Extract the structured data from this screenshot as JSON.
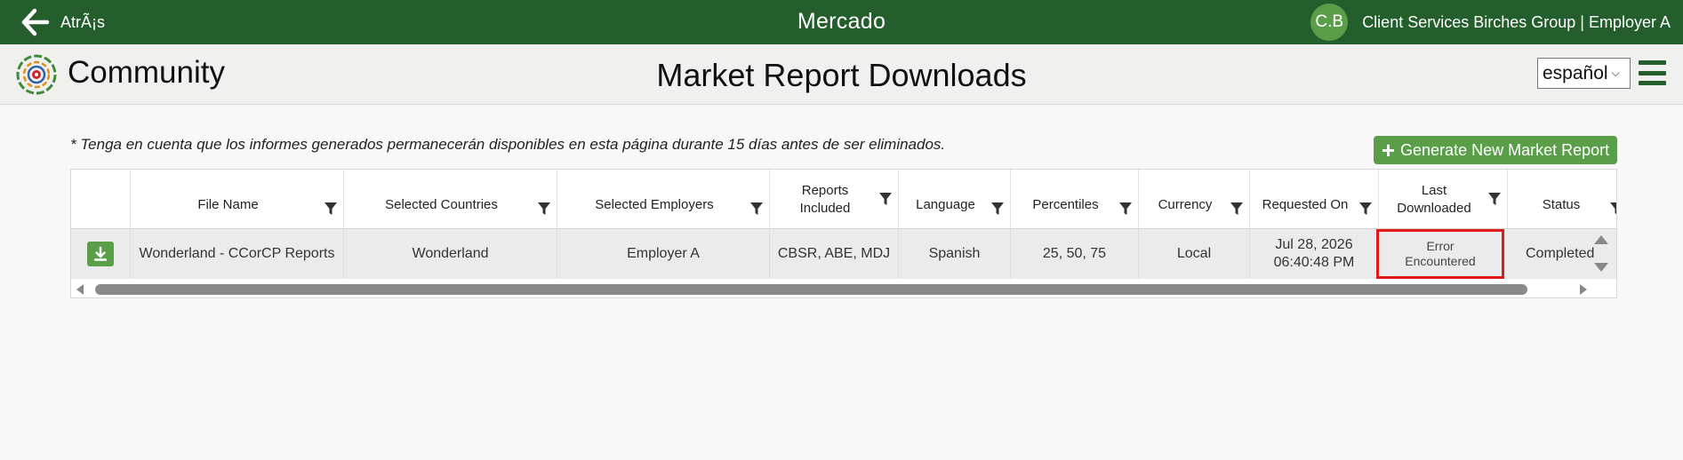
{
  "topbar": {
    "back_label": "AtrÃ¡s",
    "app_title": "Mercado",
    "avatar_initials": "C.B",
    "user_name": "Client Services Birches Group | Employer A"
  },
  "header": {
    "brand": "Community",
    "page_title": "Market Report Downloads",
    "language_selected": "español",
    "menu_icon": "hamburger-icon"
  },
  "note": "* Tenga en cuenta que los informes generados permanecerán disponibles en esta página durante 15 días antes de ser eliminados.",
  "generate_button": {
    "label": "Generate New Market Report",
    "icon": "plus-icon"
  },
  "table": {
    "columns": [
      {
        "key": "download",
        "label": ""
      },
      {
        "key": "file_name",
        "label": "File Name"
      },
      {
        "key": "countries",
        "label": "Selected Countries"
      },
      {
        "key": "employers",
        "label": "Selected Employers"
      },
      {
        "key": "reports",
        "label": "Reports Included"
      },
      {
        "key": "language",
        "label": "Language"
      },
      {
        "key": "percentiles",
        "label": "Percentiles"
      },
      {
        "key": "currency",
        "label": "Currency"
      },
      {
        "key": "requested",
        "label": "Requested On"
      },
      {
        "key": "last_downloaded",
        "label": "Last Downloaded"
      },
      {
        "key": "status",
        "label": "Status"
      }
    ],
    "rows": [
      {
        "file_name": "Wonderland - CCorCP Reports",
        "countries": "Wonderland",
        "employers": "Employer A",
        "reports": "CBSR, ABE, MDJ",
        "language": "Spanish",
        "percentiles": "25, 50, 75",
        "currency": "Local",
        "requested_date": "Jul 28, 2026",
        "requested_time": "06:40:48 PM",
        "last_downloaded": "Error Encountered",
        "status": "Completed"
      }
    ]
  },
  "colors": {
    "topbar": "#245e2c",
    "accent": "#5a9e4a",
    "error_outline": "#e01a1a"
  }
}
